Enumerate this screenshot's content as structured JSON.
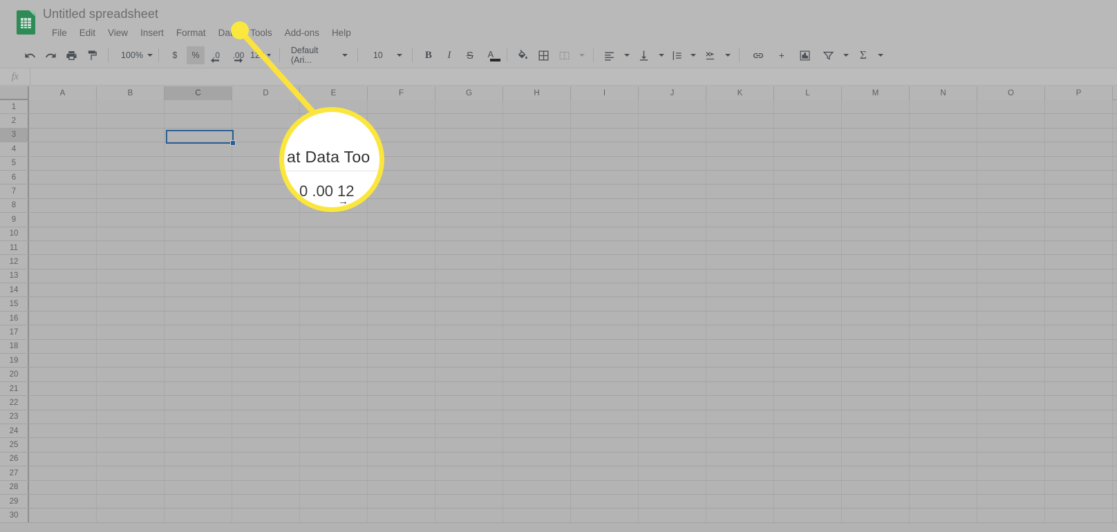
{
  "app": {
    "name": "Google Sheets",
    "logo_color": "#2e8a57"
  },
  "header": {
    "doc_title": "Untitled spreadsheet",
    "menu_items": [
      {
        "label": "File"
      },
      {
        "label": "Edit"
      },
      {
        "label": "View"
      },
      {
        "label": "Insert"
      },
      {
        "label": "Format"
      },
      {
        "label": "Data"
      },
      {
        "label": "Tools"
      },
      {
        "label": "Add-ons"
      },
      {
        "label": "Help"
      }
    ]
  },
  "toolbar": {
    "undo": "undo-arrow",
    "redo": "redo-arrow",
    "print": "printer",
    "paint_format": "paint-roller",
    "zoom_value": "100%",
    "currency": "$",
    "percent": "%",
    "decrease_decimal": ".0",
    "increase_decimal": ".00",
    "more_formats": "123",
    "font_family": "Default (Ari...",
    "font_size": "10",
    "bold": "B",
    "italic": "I",
    "strikethrough": "S",
    "text_color": "A",
    "fill_color": "paint-bucket",
    "borders": "borders-grid",
    "merge_cells": "merge-cells",
    "horizontal_align": "align-left",
    "vertical_align": "align-bottom",
    "text_wrap": "text-wrapping",
    "text_rotation": "text-rotation",
    "insert_link": "link",
    "insert_comment": "comment-plus",
    "insert_chart": "chart",
    "create_filter": "filter-funnel",
    "functions": "sigma-sum"
  },
  "formula_bar": {
    "name_box_icon": "fx",
    "value": "",
    "placeholder": ""
  },
  "grid": {
    "columns": [
      "A",
      "B",
      "C",
      "D",
      "E",
      "F",
      "G",
      "H",
      "I",
      "J",
      "K",
      "L",
      "M",
      "N",
      "O",
      "P"
    ],
    "active_column": "C",
    "rows": [
      1,
      2,
      3,
      4,
      5,
      6,
      7,
      8,
      9,
      10,
      11,
      12,
      13,
      14,
      15,
      16,
      17,
      18,
      19,
      20,
      21,
      22,
      23,
      24,
      25,
      26,
      27,
      28,
      29,
      30
    ],
    "active_row": 3,
    "selected_cell": "C3"
  },
  "callout": {
    "target_menu_item": "Tools",
    "dot_color": "#fbe83f",
    "line_color": "#fbe23c",
    "ring_color": "#fbe63e",
    "magnified_menu_text": "at  Data  Too",
    "magnified_toolbar_text": "0   .00   12",
    "magnified_arrow": "→"
  }
}
